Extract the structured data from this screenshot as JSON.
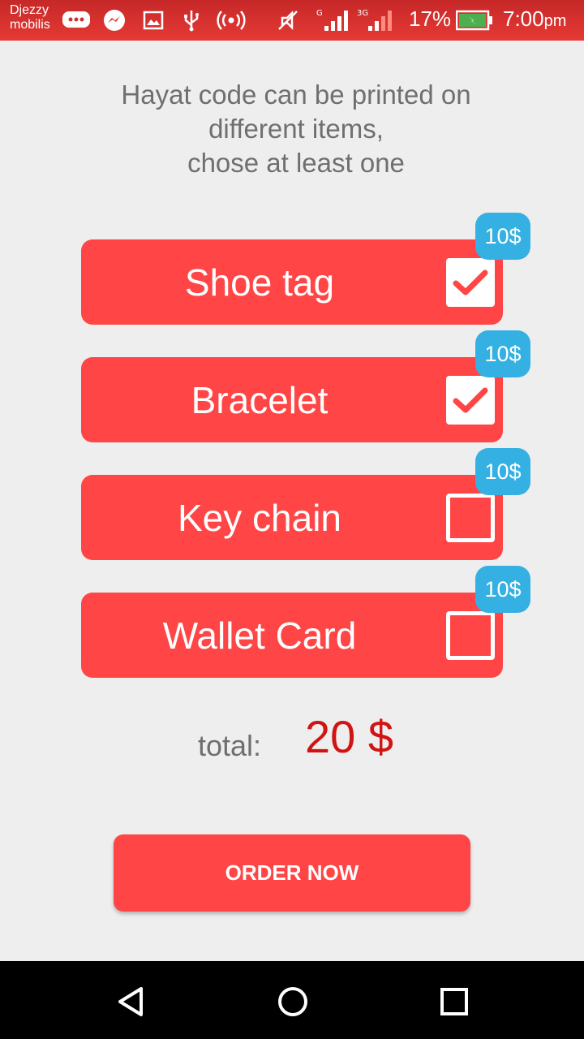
{
  "status_bar": {
    "carrier_line1": "Djezzy",
    "carrier_line2": "mobilis",
    "net1_label": "G",
    "net2_label": "3G",
    "battery_percent": "17%",
    "time": "7:00",
    "time_suffix": "pm",
    "icons": [
      "chat-bubble-icon",
      "messenger-icon",
      "image-icon",
      "usb-icon",
      "hotspot-icon",
      "mute-icon",
      "signal-icon",
      "signal-icon",
      "battery-charging-icon"
    ]
  },
  "instruction": {
    "line1": "Hayat code can be printed on",
    "line2": "different items,",
    "line3": "chose at least one"
  },
  "items": [
    {
      "label": "Shoe tag",
      "price": "10$",
      "checked": true
    },
    {
      "label": "Bracelet",
      "price": "10$",
      "checked": true
    },
    {
      "label": "Key chain",
      "price": "10$",
      "checked": false
    },
    {
      "label": "Wallet Card",
      "price": "10$",
      "checked": false
    }
  ],
  "total": {
    "label": "total:",
    "value": "20 $"
  },
  "order_button": {
    "label": "ORDER NOW"
  },
  "navigation": {
    "icons": [
      "back-icon",
      "home-icon",
      "recents-icon"
    ]
  },
  "colors": {
    "accent": "#ff4545",
    "badge": "#35b0e3",
    "total_value": "#d11313",
    "background": "#eeeeee"
  }
}
